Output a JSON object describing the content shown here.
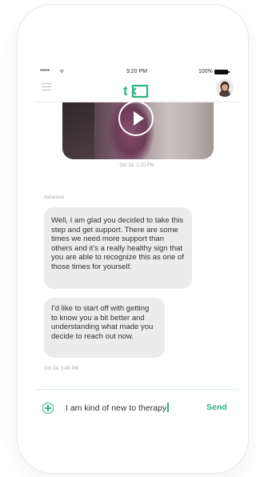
{
  "status_bar": {
    "signal": "•••••",
    "wifi": "ᯤ",
    "time": "9:20 PM",
    "battery": "100%"
  },
  "nav": {
    "logo": "t",
    "menu_icon": "hamburger-icon",
    "avatar_icon": "profile-avatar"
  },
  "video": {
    "timestamp": "Oct 24, 2:20 PM",
    "play_icon": "play-icon"
  },
  "conversation": {
    "sender": "Vanessa",
    "messages": [
      {
        "text": "Well, I am glad you decided to take this step and get support. There are some times we need more support than others and it’s a really healthy sign that you are able to recognize this as one of those times for yourself."
      },
      {
        "text": "I’d like to start off with getting to know you a bit better and understanding what made you decide to reach out now."
      }
    ],
    "timestamp": "Oct 24, 3:45 PM"
  },
  "composer": {
    "value": "I am kind of new to therapy",
    "send_label": "Send",
    "add_icon": "plus-circle-icon"
  },
  "colors": {
    "accent": "#2fb37f",
    "bubble": "#ececec",
    "muted_text": "#a6a9ad"
  }
}
